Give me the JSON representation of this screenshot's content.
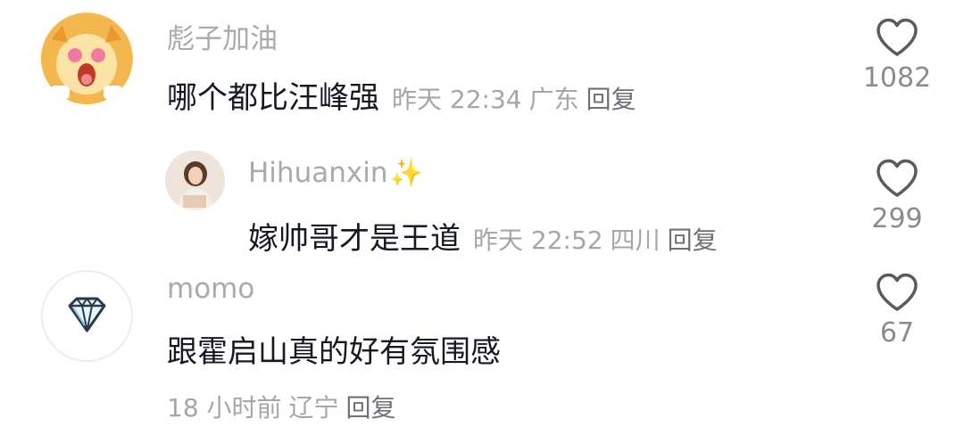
{
  "comments": [
    {
      "username": "彪子加油",
      "text": "哪个都比汪峰强",
      "time": "昨天 22:34",
      "location": "广东",
      "reply_label": "回复",
      "likes": "1082",
      "avatar_icon": "cartoon-lion-avatar"
    },
    {
      "username": "Hihuanxin",
      "username_emoji": "✨",
      "text": "嫁帅哥才是王道",
      "time": "昨天 22:52",
      "location": "四川",
      "reply_label": "回复",
      "likes": "299",
      "avatar_icon": "person-photo-avatar"
    },
    {
      "username": "momo",
      "text": "跟霍启山真的好有氛围感",
      "time": "18 小时前",
      "location": "辽宁",
      "reply_label": "回复",
      "likes": "67",
      "avatar_icon": "diamond-avatar"
    }
  ],
  "colors": {
    "username": "#a9a9ae",
    "text": "#161823",
    "meta": "#a5a5aa",
    "reply": "#6f6f75",
    "like_icon": "#5a5a60"
  }
}
